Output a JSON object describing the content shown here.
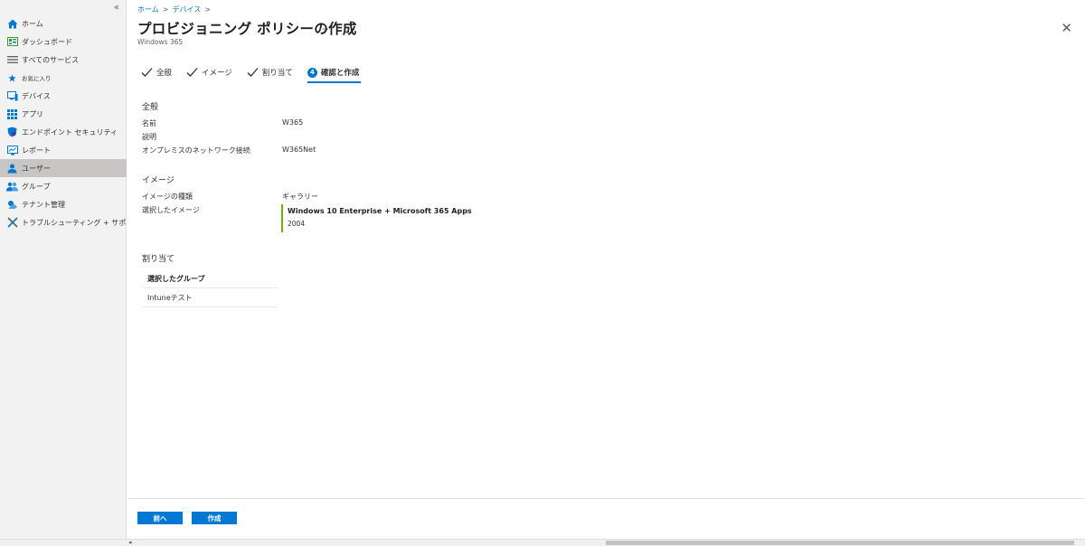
{
  "sidebar": {
    "collapse_label": "«",
    "items": [
      {
        "label": "ホーム",
        "icon": "home-icon",
        "color": "#0078d4"
      },
      {
        "label": "ダッシュボード",
        "icon": "dashboard-icon",
        "color": "#3a9a3a"
      },
      {
        "label": "すべてのサービス",
        "icon": "list-icon",
        "color": "#605e5c"
      },
      {
        "label": "お気に入り",
        "icon": "star-icon",
        "color": "#0078d4"
      },
      {
        "label": "デバイス",
        "icon": "device-icon",
        "color": "#0078d4"
      },
      {
        "label": "アプリ",
        "icon": "apps-grid-icon",
        "color": "#0078d4"
      },
      {
        "label": "エンドポイント セキュリティ",
        "icon": "shield-icon",
        "color": "#0078d4"
      },
      {
        "label": "レポート",
        "icon": "report-icon",
        "color": "#0078d4"
      },
      {
        "label": "ユーザー",
        "icon": "user-icon",
        "color": "#0078d4"
      },
      {
        "label": "グループ",
        "icon": "group-icon",
        "color": "#0078d4"
      },
      {
        "label": "テナント管理",
        "icon": "tenant-icon",
        "color": "#0078d4"
      },
      {
        "label": "トラブルシューティング + サポート",
        "icon": "tools-icon",
        "color": "#0078d4"
      }
    ]
  },
  "breadcrumb": {
    "home": "ホーム",
    "devices": "デバイス",
    "sep": ">"
  },
  "header": {
    "title": "プロビジョニング ポリシーの作成",
    "more": "…",
    "subtitle": "Windows 365",
    "close": "✕"
  },
  "steps": [
    {
      "label": "全般",
      "state": "done"
    },
    {
      "label": "イメージ",
      "state": "done"
    },
    {
      "label": "割り当て",
      "state": "done"
    },
    {
      "label": "確認と作成",
      "state": "current",
      "number": "4"
    }
  ],
  "review": {
    "general": {
      "title": "全般",
      "name_label": "名前",
      "name_value": "W365",
      "desc_label": "説明",
      "desc_value": "",
      "network_label": "オンプレミスのネットワーク接続",
      "network_value": "W365Net"
    },
    "image": {
      "title": "イメージ",
      "type_label": "イメージの種類",
      "type_value": "ギャラリー",
      "selected_label": "選択したイメージ",
      "selected_name": "Windows 10 Enterprise + Microsoft 365 Apps",
      "selected_version": "2004"
    },
    "assignment": {
      "title": "割り当て",
      "column_header": "選択したグループ",
      "groups": [
        "Intuneテスト"
      ]
    }
  },
  "footer": {
    "prev_label": "前へ",
    "create_label": "作成"
  },
  "scrollbar": {
    "left_arrow": "◂"
  },
  "colors": {
    "accent": "#0078d4",
    "image_border": "#6bb700",
    "sidebar_bg": "#f2f2f2",
    "sidebar_active": "#c8c6c4"
  }
}
